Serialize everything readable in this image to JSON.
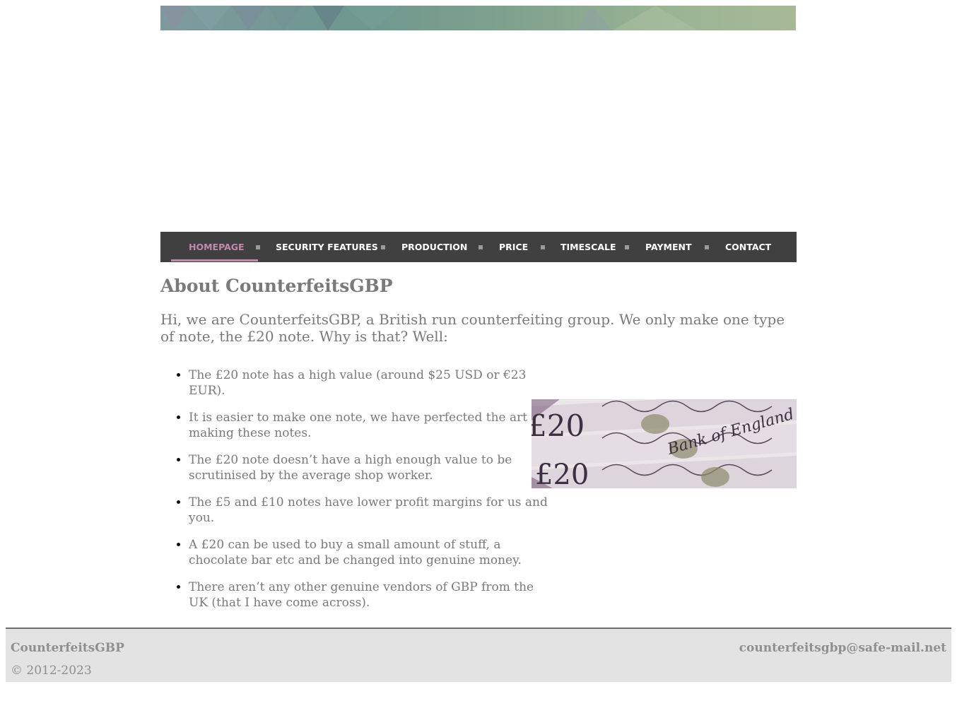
{
  "nav": {
    "items": [
      {
        "label": "HOMEPAGE",
        "active": true
      },
      {
        "label": "SECURITY FEATURES",
        "active": false
      },
      {
        "label": "PRODUCTION",
        "active": false
      },
      {
        "label": "PRICE",
        "active": false
      },
      {
        "label": "TIMESCALE",
        "active": false
      },
      {
        "label": "PAYMENT",
        "active": false
      },
      {
        "label": "CONTACT",
        "active": false
      }
    ],
    "active_color": "#c08aaa",
    "bar_color": "#404040"
  },
  "main": {
    "title": "About CounterfeitsGBP",
    "intro": " Hi, we are CounterfeitsGBP, a British run counterfeiting group. We only make one type of note, the £20 note. Why is that? Well:",
    "reasons": [
      "The £20 note has a high value (around $25 USD or €23 EUR).",
      "It is easier to make one note, we have perfected the art of making these notes.",
      "The £20 note doesn’t have a high enough value to be scrutinised by the average shop worker.",
      "The £5 and £10 notes have lower profit margins for us and you.",
      "A £20 can be used to buy a small amount of stuff, a chocolate bar etc and be changed into genuine money.",
      "There aren’t any other genuine vendors of GBP from the UK (that I have come across)."
    ],
    "image": {
      "note_values": [
        "£20",
        "£20"
      ],
      "note_inscription": "Bank of England"
    }
  },
  "footer": {
    "brand": "CounterfeitsGBP",
    "copyright": "© 2012-2023",
    "email": "counterfeitsgbp@safe-mail.net"
  }
}
